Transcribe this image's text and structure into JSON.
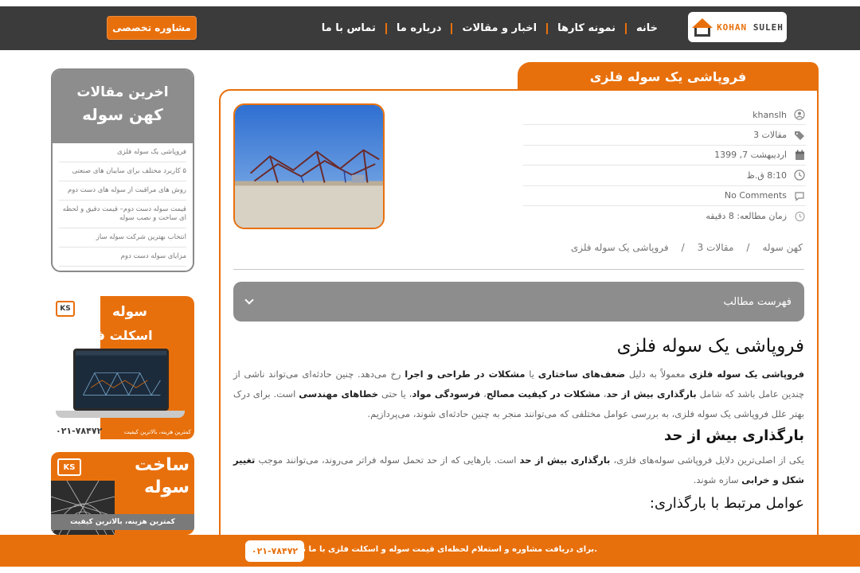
{
  "header": {
    "logo_text_1": "KOHAN",
    "logo_text_2": "SULEH",
    "nav": [
      "خانه",
      "نمونه کارها",
      "اخبار و مقالات",
      "درباره ما",
      "تماس با ما"
    ],
    "cta_label": "مشاوره تخصصی"
  },
  "sidebar": {
    "recent_title": "اخرین مقالات",
    "recent_subtitle": "کهن سوله",
    "recent_items": [
      "فروپاشی یک سوله فلزی",
      "۵ کاربرد مختلف برای سایبان های صنعتی",
      "روش های مراقبت از سوله های دست دوم",
      "قیمت سوله دست دوم– قیمت دقیق و لحظه ای ساخت و نصب سوله",
      "انتخاب بهترین شرکت سوله ساز",
      "مزایای سوله دست دوم"
    ],
    "ad1": {
      "logo": "KS",
      "line1": "سوله",
      "line2": "اسکلت فلزی",
      "phone": "۰۲۱-۷۸۴۷۲",
      "slogan": "کمترین هزینه، بالاترین کیفیت"
    },
    "ad2": {
      "logo": "KS",
      "line1": "ساخت",
      "line2": "سوله",
      "slogan": "کمترین هزینه، بالاترین کیفیت"
    }
  },
  "post": {
    "title": "فروپاشی یک سوله فلزی",
    "meta": {
      "author": "khanslh",
      "category": "مقالات 3",
      "date": "اردیبهشت 7, 1399",
      "time": "8:10 ق.ظ",
      "comments": "No Comments",
      "reading": "زمان مطالعه: 8 دقیقه"
    },
    "breadcrumb": [
      "کهن سوله",
      "/",
      "مقالات 3",
      "/",
      "فروپاشی یک سوله فلزی"
    ],
    "toc_label": "فهرست مطالب",
    "h1": "فروپاشی یک سوله فلزی",
    "p1": {
      "a": "فروپاشی یک سوله فلزی",
      "b": " معمولاً به دلیل ",
      "c": "ضعف‌های ساختاری",
      "d": " یا ",
      "e": "مشکلات در طراحی و اجرا",
      "f": " رخ می‌دهد. چنین حادثه‌ای می‌تواند ناشی از چندین عامل باشد که شامل ",
      "g": "بارگذاری بیش از حد",
      "h": "، ",
      "i": "مشکلات در کیفیت مصالح",
      "j": "، ",
      "k": "فرسودگی مواد",
      "l": "، یا حتی ",
      "m": "خطاهای مهندسی",
      "n": " است. برای درک بهتر علل فروپاشی یک سوله فلزی، به بررسی عوامل مختلفی که می‌توانند منجر به چنین حادثه‌ای شوند، می‌پردازیم."
    },
    "h2": "بارگذاری بیش از حد",
    "p2": {
      "a": "یکی از اصلی‌ترین دلایل فروپاشی سوله‌های فلزی، ",
      "b": "بارگذاری بیش از حد",
      "c": " است. بارهایی که از حد تحمل سوله فراتر می‌روند، می‌توانند موجب ",
      "d": "تغییر شکل و خرابی",
      "e": " سازه شوند."
    },
    "h3": "عوامل مرتبط با بارگذاری:"
  },
  "footer": {
    "message": "برای دریافت مشاوره و استعلام لحظه‌ای قیمت سوله و اسکلت فلزی با ما تماس بگیرید.",
    "phone": "۰۲۱-۷۸۴۷۲"
  },
  "colors": {
    "accent": "#e8700c",
    "dark": "#3b3b3b",
    "gray": "#8d8d8d"
  }
}
